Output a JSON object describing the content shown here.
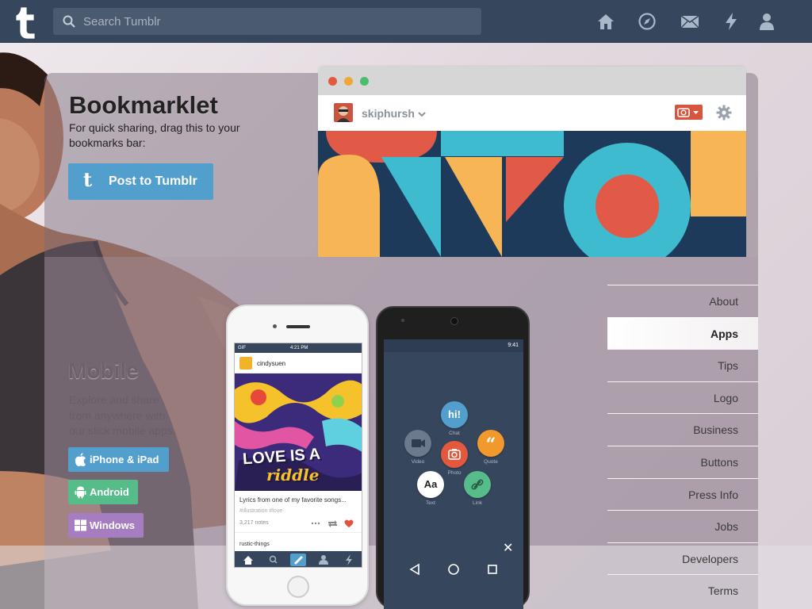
{
  "topbar": {
    "search_placeholder": "Search Tumblr",
    "nav_icons": [
      "home-icon",
      "explore-icon",
      "inbox-icon",
      "activity-icon",
      "account-icon"
    ]
  },
  "bookmarklet": {
    "title": "Bookmarklet",
    "description": "For quick sharing, drag this to your bookmarks bar:",
    "button_label": "Post to Tumblr"
  },
  "browser_mock": {
    "blog_name": "skiphursh"
  },
  "mobile": {
    "title": "Mobile",
    "description": "Explore and share from anywhere with our slick mobile apps.",
    "buttons": [
      {
        "label": "iPhone & iPad",
        "color": "#529ecc"
      },
      {
        "label": "Android",
        "color": "#56bc8a"
      },
      {
        "label": "Windows",
        "color": "#a77dc2"
      }
    ]
  },
  "iphone_mock": {
    "time": "4:21 PM",
    "carrier": "GIF",
    "username": "cindysuen",
    "art_text_1": "LOVE IS A",
    "art_text_2": "riddle",
    "caption": "Lyrics from one of my favorite songs...",
    "tags": "#illustration  #love",
    "notes": "3,217 notes",
    "next_user": "rustic-things"
  },
  "android_mock": {
    "time": "9:41",
    "bubbles": [
      {
        "glyph": "hi!",
        "label": "Chat"
      },
      {
        "glyph": "■",
        "label": "Video"
      },
      {
        "glyph": "“",
        "label": "Quote"
      },
      {
        "glyph": "◎",
        "label": "Photo"
      },
      {
        "glyph": "Aa",
        "label": "Text"
      },
      {
        "glyph": "∞",
        "label": "Link"
      }
    ]
  },
  "sidenav": {
    "items": [
      "About",
      "Apps",
      "Tips",
      "Logo",
      "Business",
      "Buttons",
      "Press Info",
      "Jobs",
      "Developers",
      "Terms"
    ],
    "active": "Apps"
  },
  "colors": {
    "topbar": "#36465d",
    "accent_blue": "#529ecc",
    "android_green": "#56bc8a",
    "windows_purple": "#a77dc2",
    "camera_red": "#d6553c"
  }
}
